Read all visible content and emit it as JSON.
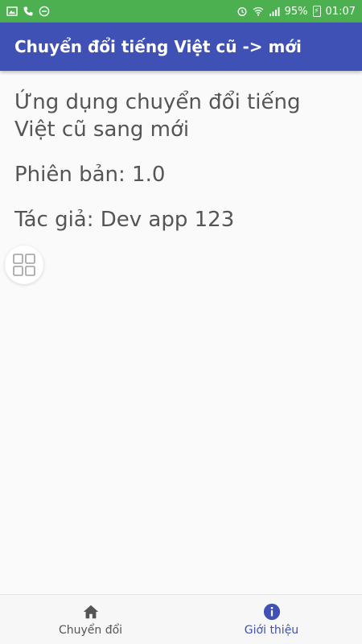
{
  "status_bar": {
    "battery_percent": "95%",
    "time": "01:07",
    "battery_badge": "⚡"
  },
  "app_bar": {
    "title": "Chuyển đổi tiếng Việt cũ -> mới"
  },
  "content": {
    "description": "Ứng dụng chuyển đổi tiếng Việt cũ sang mới",
    "version": "Phiên bản: 1.0",
    "author": "Tác giả: Dev app 123"
  },
  "bottom_nav": {
    "items": [
      {
        "label": "Chuyển đổi",
        "icon": "home-icon",
        "active": false
      },
      {
        "label": "Giới thiệu",
        "icon": "info-icon",
        "active": true
      }
    ]
  },
  "colors": {
    "status_bar": "#4caf50",
    "app_bar": "#3f51b5",
    "accent": "#3f51b5",
    "text": "#555555",
    "inactive_icon": "#555555"
  }
}
